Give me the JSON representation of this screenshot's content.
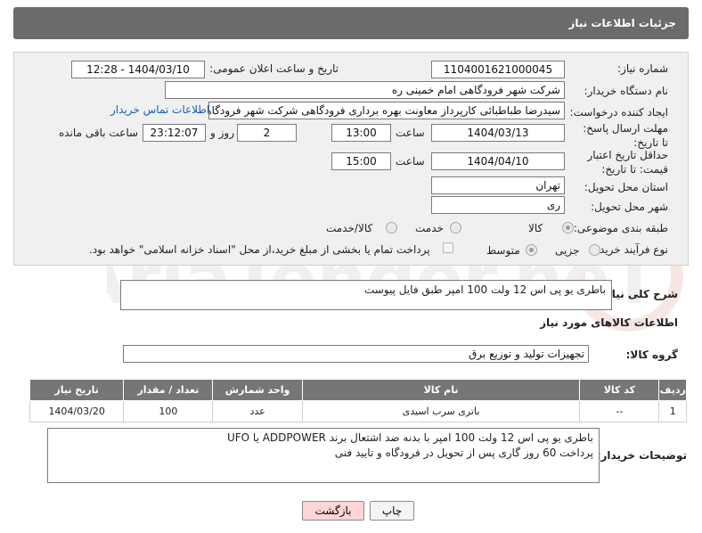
{
  "header": {
    "title": "جزئیات اطلاعات نیاز"
  },
  "form": {
    "need_number_label": "شماره نیاز:",
    "need_number": "1104001621000045",
    "announce_label": "تاریخ و ساعت اعلان عمومی:",
    "announce_value": "1404/03/10 - 12:28",
    "buyer_org_label": "نام دستگاه خریدار:",
    "buyer_org": "شرکت شهر فرودگاهی امام خمینی  ره",
    "requester_label": "ایجاد کننده درخواست:",
    "requester": "سیدرضا طباطبائی کارپرداز معاونت بهره برداری فرودگاهی شرکت شهر فرودگاهی امام",
    "contact_link": "اطلاعات تماس خریدار",
    "deadline_label": "مهلت ارسال پاسخ: تا تاریخ:",
    "deadline_date": "1404/03/13",
    "time_label": "ساعت",
    "deadline_time": "13:00",
    "days_value": "2",
    "days_label": "روز و",
    "remaining_time": "23:12:07",
    "remaining_label": "ساعت باقی مانده",
    "validity_label": "حداقل تاریخ اعتبار قیمت: تا تاریخ:",
    "validity_date": "1404/04/10",
    "validity_time": "15:00",
    "province_label": "استان محل تحویل:",
    "province": "تهران",
    "city_label": "شهر محل تحویل:",
    "city": "ری",
    "category_label": "طبقه بندی موضوعی:",
    "category_options": [
      "کالا",
      "خدمت",
      "کالا/خدمت"
    ],
    "purchase_type_label": "نوع فرآیند خرید :",
    "purchase_options": [
      "جزیی",
      "متوسط"
    ],
    "payment_note": "پرداخت تمام یا بخشی از مبلغ خرید،از محل \"اسناد خزانه اسلامی\" خواهد بود."
  },
  "description": {
    "label": "شرح کلی نیاز:",
    "text": "باطری  یو پی اس 12 ولت 100 امپر طبق فایل پیوست"
  },
  "goods": {
    "section_title": "اطلاعات کالاهای مورد نیاز",
    "group_label": "گروه کالا:",
    "group_value": "تجهیزات تولید و توزیع برق",
    "columns": [
      "ردیف",
      "کد کالا",
      "نام کالا",
      "واحد شمارش",
      "تعداد / مقدار",
      "تاریخ نیاز"
    ],
    "rows": [
      {
        "row": "1",
        "code": "--",
        "name": "باتری سرب اسیدی",
        "unit": "عدد",
        "qty": "100",
        "date": "1404/03/20"
      }
    ]
  },
  "buyer_notes": {
    "label": "توضیحات خریدار:",
    "line1": "باطری یو پی اس 12 ولت 100 امپر با بدنه ضد اشتعال برند ADDPOWER یا UFO",
    "line2": "پرداخت 60 روز گاری پس از تحویل در فرودگاه و تایید فنی"
  },
  "buttons": {
    "print": "چاپ",
    "back": "بازگشت"
  },
  "watermark": {
    "text": "AriaTender.neT"
  }
}
